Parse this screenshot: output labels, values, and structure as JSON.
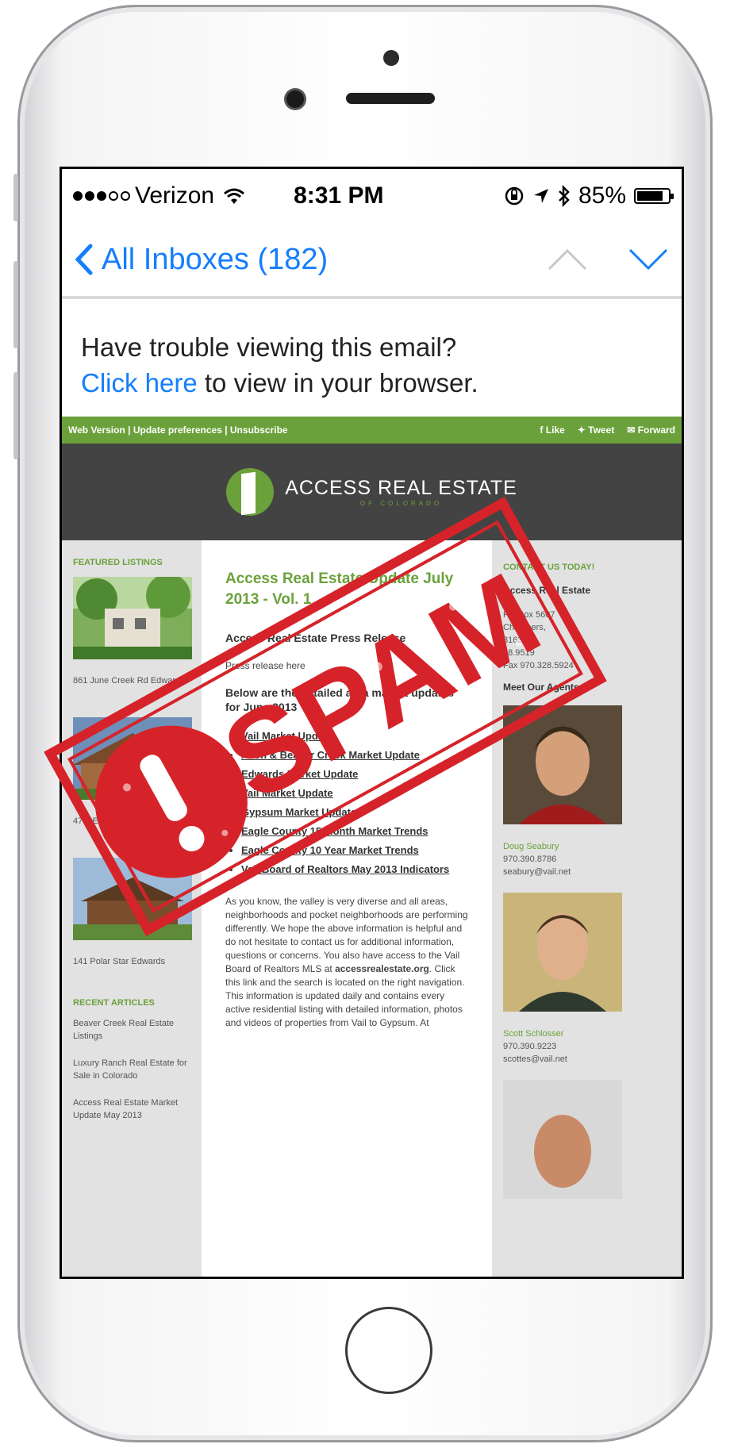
{
  "status_bar": {
    "carrier": "Verizon",
    "time": "8:31 PM",
    "battery_label": "85%",
    "battery_level": 0.85
  },
  "nav": {
    "back_label": "All Inboxes (182)",
    "up_icon": "chevron-up-icon",
    "down_icon": "chevron-down-icon"
  },
  "notice": {
    "line1": "Have trouble viewing this email?",
    "link": "Click here",
    "line2_rest": " to view in your browser."
  },
  "email": {
    "topbar_left": "Web Version  |  Update preferences  |  Unsubscribe",
    "topbar_like": "f Like",
    "topbar_tweet": "Tweet",
    "topbar_forward": "Forward",
    "brand_name": "ACCESS REAL ESTATE",
    "brand_sub": "OF COLORADO",
    "left": {
      "featured_title": "FEATURED LISTINGS",
      "listings": [
        "861 June Creek Rd Edwards",
        "47 A Edwards",
        "141 Polar Star Edwards"
      ],
      "articles_title": "RECENT ARTICLES",
      "articles": [
        "Beaver Creek Real Estate Listings",
        "Luxury Ranch Real Estate for Sale in Colorado",
        "Access Real Estate Market Update May 2013"
      ]
    },
    "main": {
      "title": "Access Real Estate Update July 2013 - Vol. 1",
      "press_heading": "Access Real Estate Press Release",
      "press_text": "Press release here",
      "below_heading": "Below are the detailed area market updates for June 2013",
      "links": [
        "Vail Market Update",
        "Avon & Beaver Creek Market Update",
        "Edwards Market Update",
        "Vail Market Update",
        "Gypsum Market Update",
        "Eagle County 15 Month Market Trends",
        "Eagle County 10 Year Market Trends",
        "Vail Board of Realtors May 2013 Indicators"
      ],
      "body_text": "As you know, the valley is very diverse and all areas, neighborhoods and pocket neighborhoods are performing differently. We hope the above information is helpful and do not hesitate to contact us for additional information, questions or concerns. You also have access to the Vail Board of Realtors MLS at",
      "site": "accessrealestate.org",
      "body_text2": ". Click this link and the search is located on the right navigation. This information is updated daily and contains every active residential listing with detailed information, photos and videos of properties from Vail to Gypsum. At"
    },
    "right": {
      "contact_title": "CONTACT US TODAY!",
      "company": "Access Real Estate",
      "lines": [
        "PO Box 5607",
        "Chambers,",
        "81631",
        "28.9519",
        "Fax 970.328.5924"
      ],
      "meet_title": "Meet Our Agents",
      "agents": [
        {
          "name": "Doug Seabury",
          "phone": "970.390.8786",
          "email": "seabury@vail.net"
        },
        {
          "name": "Scott Schlosser",
          "phone": "970.390.9223",
          "email": "scottes@vail.net"
        }
      ]
    }
  },
  "stamp": {
    "text": "SPAM",
    "color": "#d6232a"
  },
  "colors": {
    "ios_blue": "#157efb",
    "brand_green": "#6ba13b",
    "banner_gray": "#434343"
  }
}
